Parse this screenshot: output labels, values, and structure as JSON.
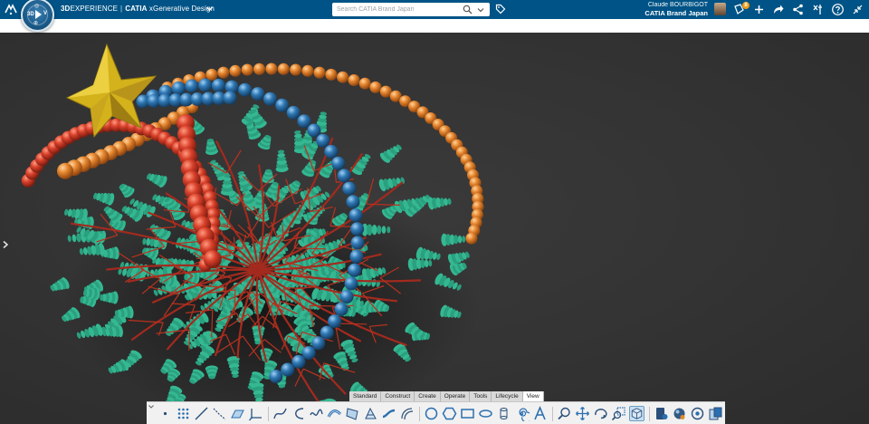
{
  "topbar": {
    "brand_prefix": "3D",
    "brand_experience": "EXPERIENCE",
    "brand_separator": "|",
    "brand_catia": "CATIA",
    "app_name": "xGenerative Design",
    "search_placeholder": "Search CATIA Brand Japan",
    "user_name": "Claude BOURBIGOT",
    "tenant": "CATIA Brand Japan",
    "notification_count": "8",
    "compass": {
      "top": "◎",
      "left": "3D",
      "right": "V",
      "bottom": "⊕"
    }
  },
  "icons": {
    "topbar": [
      "ds-logo-icon",
      "compass-icon",
      "app-menu-chevron-icon",
      "search-icon",
      "search-dropdown-icon",
      "tag-icon",
      "user-avatar",
      "notifications-icon",
      "add-icon",
      "share-icon",
      "network-icon",
      "tools-icon",
      "help-icon",
      "collapse-icon"
    ],
    "actionbar": [
      "point-icon",
      "grid-points-icon",
      "line-icon",
      "polyline-icon",
      "plane-icon",
      "axis-system-icon",
      "spline-icon",
      "curve-icon",
      "wave-icon",
      "sweep-icon",
      "surface-icon",
      "loft-icon",
      "blend-icon",
      "offset-curve-icon",
      "circle-icon",
      "hexagon-icon",
      "rectangle-icon",
      "ellipse-icon",
      "cylinder-icon",
      "spiral-icon",
      "text-icon",
      "zoom-icon",
      "pan-icon",
      "rotate-icon",
      "zoom-area-icon",
      "view-mode-icon",
      "render-icon",
      "material-icon",
      "capture-icon",
      "publish-icon"
    ]
  },
  "actionbar": {
    "tabs": [
      "Standard",
      "Construct",
      "Create",
      "Operate",
      "Tools",
      "Lifecycle",
      "View"
    ],
    "active_tab": "View"
  },
  "colors": {
    "topbar": "#005386",
    "viewport_bg": "#333333",
    "star": "#d4b21c",
    "red_beads": "#d23a22",
    "blue_beads": "#2f78b4",
    "orange_beads": "#e0802c",
    "foliage": "#2aa07f",
    "branches": "#a32a1e"
  }
}
